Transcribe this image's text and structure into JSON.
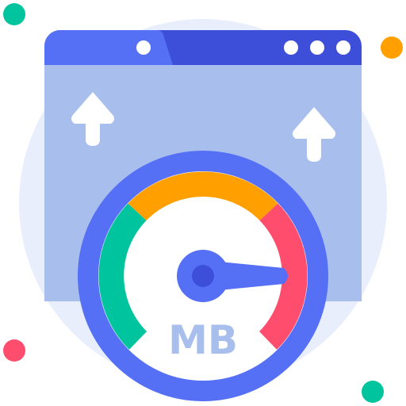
{
  "icon": {
    "name": "speed-test-icon",
    "unit_label": "MB",
    "gauge_segments": [
      "green",
      "orange",
      "red"
    ],
    "window_dots": 3,
    "arrows": [
      "arrow-up-icon",
      "arrow-up-icon"
    ],
    "decor_dots": [
      "green",
      "orange",
      "red",
      "green"
    ]
  },
  "colors": {
    "background_circle": "#E9EEFC",
    "window_body": "#A8BEEC",
    "window_titlebar": "#3D4FD8",
    "window_tab": "#5570F5",
    "gauge_ring": "#5570F5",
    "gauge_face": "#FFFFFF",
    "segment_green": "#00C49E",
    "segment_orange": "#FFA000",
    "segment_red": "#FF4D6D",
    "needle": "#5570F5",
    "needle_hub": "#3D4FD8",
    "unit_text": "#A8BEEC",
    "arrow": "#FFFFFF"
  }
}
